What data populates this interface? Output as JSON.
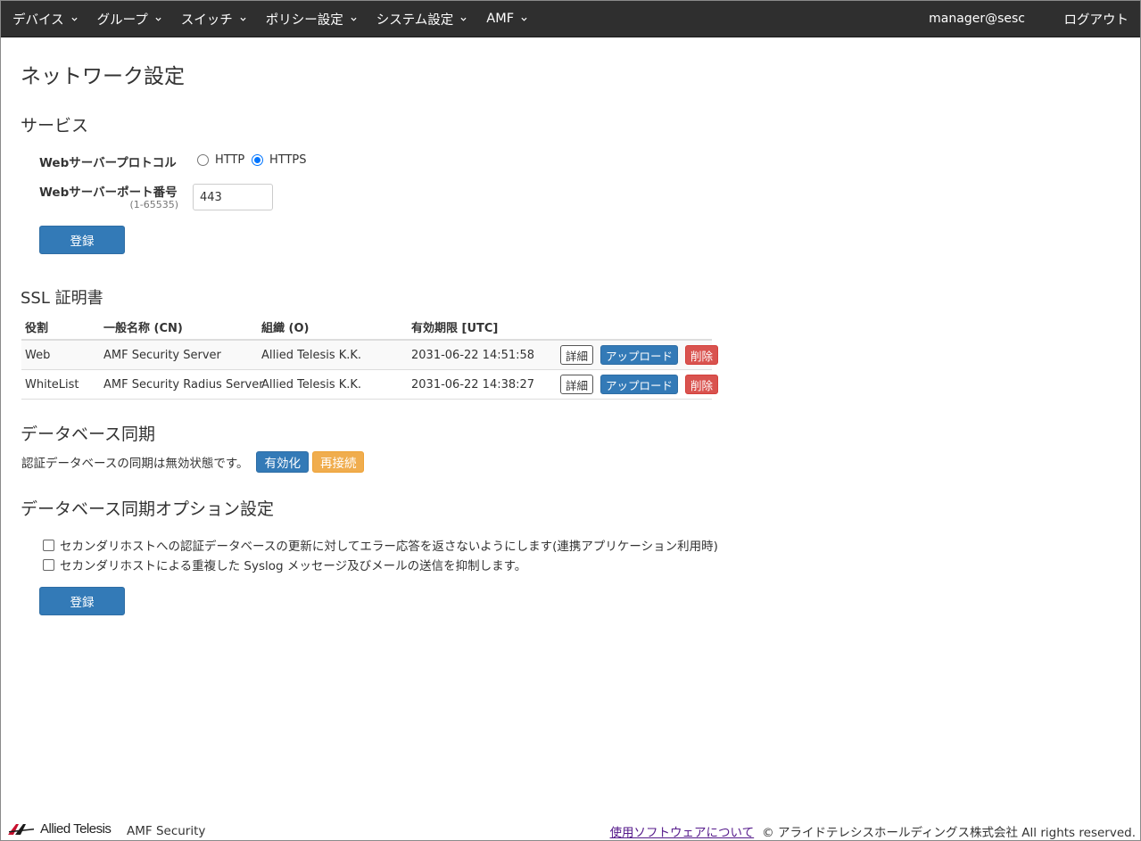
{
  "navbar": {
    "menu": [
      {
        "label": "デバイス"
      },
      {
        "label": "グループ"
      },
      {
        "label": "スイッチ"
      },
      {
        "label": "ポリシー設定"
      },
      {
        "label": "システム設定"
      },
      {
        "label": "AMF"
      }
    ],
    "user": "manager@sesc",
    "logout": "ログアウト"
  },
  "page": {
    "title": "ネットワーク設定"
  },
  "service": {
    "heading": "サービス",
    "protocol_label": "Webサーバープロトコル",
    "protocol_options": [
      {
        "label": "HTTP",
        "selected": false
      },
      {
        "label": "HTTPS",
        "selected": true
      }
    ],
    "port_label": "Webサーバーポート番号",
    "port_hint": "(1-65535)",
    "port_value": "443",
    "submit_label": "登録"
  },
  "ssl": {
    "heading": "SSL 証明書",
    "columns": [
      "役割",
      "一般名称 (CN)",
      "組織 (O)",
      "有効期限 [UTC]"
    ],
    "rows": [
      {
        "role": "Web",
        "cn": "AMF Security Server",
        "org": "Allied Telesis K.K.",
        "expires": "2031-06-22 14:51:58"
      },
      {
        "role": "WhiteList",
        "cn": "AMF Security Radius Server",
        "org": "Allied Telesis K.K.",
        "expires": "2031-06-22 14:38:27"
      }
    ],
    "actions": {
      "detail": "詳細",
      "upload": "アップロード",
      "delete": "削除"
    }
  },
  "db_sync": {
    "heading": "データベース同期",
    "status_text": "認証データベースの同期は無効状態です。",
    "enable_label": "有効化",
    "reconnect_label": "再接続"
  },
  "db_options": {
    "heading": "データベース同期オプション設定",
    "options": [
      {
        "label": "セカンダリホストへの認証データベースの更新に対してエラー応答を返さないようにします(連携アプリケーション利用時)",
        "checked": false
      },
      {
        "label": "セカンダリホストによる重複した Syslog メッセージ及びメールの送信を抑制します。",
        "checked": false
      }
    ],
    "submit_label": "登録"
  },
  "footer": {
    "logo_text": "Allied Telesis",
    "product": "AMF Security",
    "link": "使用ソフトウェアについて",
    "copyright": "© アライドテレシスホールディングス株式会社 All rights reserved."
  },
  "colors": {
    "navbar_bg": "#2f2f2f",
    "primary": "#337ab7",
    "danger": "#d9534f",
    "warning": "#f0ad4e"
  }
}
